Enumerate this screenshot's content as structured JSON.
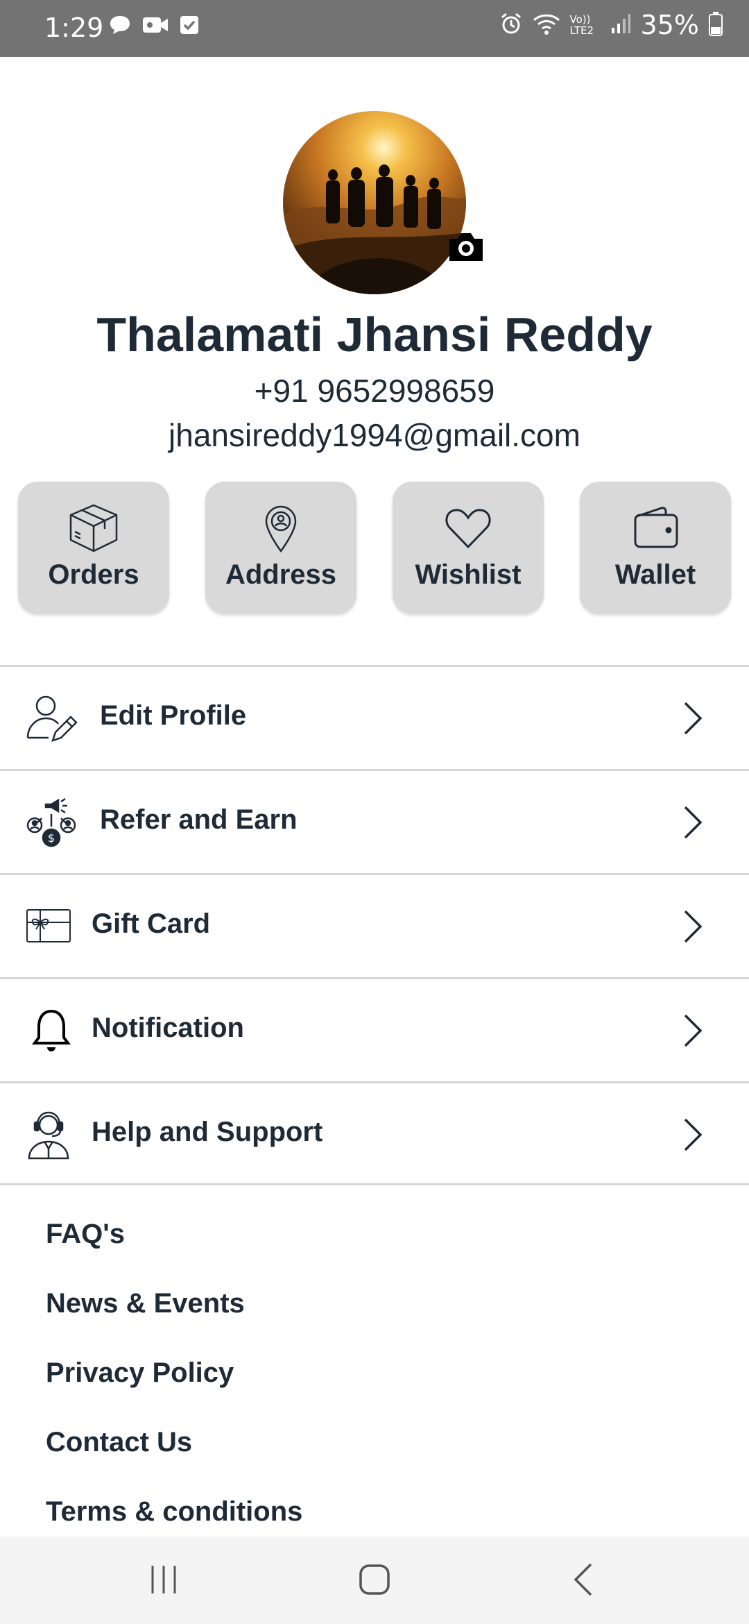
{
  "status_bar": {
    "time": "1:29",
    "battery": "35%",
    "network_label": "Vo)) LTE2",
    "icons": [
      "chat-icon",
      "video-icon",
      "check-icon",
      "alarm-icon",
      "wifi-icon",
      "signal-icon",
      "battery-icon"
    ]
  },
  "profile": {
    "name": "Thalamati Jhansi Reddy",
    "phone": "+91 9652998659",
    "email": "jhansireddy1994@gmail.com"
  },
  "tiles": [
    {
      "label": "Orders",
      "icon": "box-icon"
    },
    {
      "label": "Address",
      "icon": "location-pin-icon"
    },
    {
      "label": "Wishlist",
      "icon": "heart-icon"
    },
    {
      "label": "Wallet",
      "icon": "wallet-icon"
    }
  ],
  "menu": [
    {
      "label": "Edit Profile",
      "icon": "edit-profile-icon"
    },
    {
      "label": "Refer and Earn",
      "icon": "refer-icon"
    },
    {
      "label": "Gift Card",
      "icon": "gift-card-icon"
    },
    {
      "label": "Notification",
      "icon": "bell-icon"
    },
    {
      "label": "Help and Support",
      "icon": "support-agent-icon"
    }
  ],
  "links": [
    "FAQ's",
    "News & Events",
    "Privacy Policy",
    "Contact Us",
    "Terms & conditions"
  ],
  "colors": {
    "text": "#1f2a37",
    "tile_bg": "#d9d9d9",
    "status_bar": "#737373",
    "divider": "#d6d6d6"
  }
}
